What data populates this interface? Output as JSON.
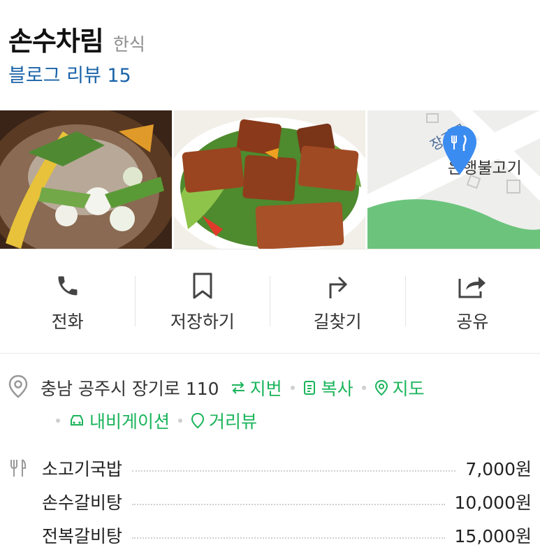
{
  "place": {
    "name": "손수차림",
    "category": "한식",
    "review": "블로그 리뷰 15"
  },
  "photos": [
    {
      "icon": "food-photo-soup"
    },
    {
      "icon": "food-photo-plate"
    },
    {
      "icon": "map-thumbnail",
      "street_label": "장기로",
      "place_label": "은행불고기"
    }
  ],
  "actions": [
    {
      "label": "전화",
      "icon": "phone-icon"
    },
    {
      "label": "저장하기",
      "icon": "bookmark-icon"
    },
    {
      "label": "길찾기",
      "icon": "directions-icon"
    },
    {
      "label": "공유",
      "icon": "share-icon"
    }
  ],
  "address": {
    "text": "충남 공주시 장기로 110",
    "links": {
      "jibun": "지번",
      "copy": "복사",
      "map": "지도",
      "navigation": "내비게이션",
      "roadview": "거리뷰"
    }
  },
  "menu": [
    {
      "name": "소고기국밥",
      "price": "7,000원"
    },
    {
      "name": "손수갈비탕",
      "price": "10,000원"
    },
    {
      "name": "전복갈비탕",
      "price": "15,000원"
    }
  ],
  "colors": {
    "link_blue": "#1a63a8",
    "green": "#1ab45a",
    "marker_blue": "#3b8cf0",
    "map_green": "#6cc47c"
  }
}
